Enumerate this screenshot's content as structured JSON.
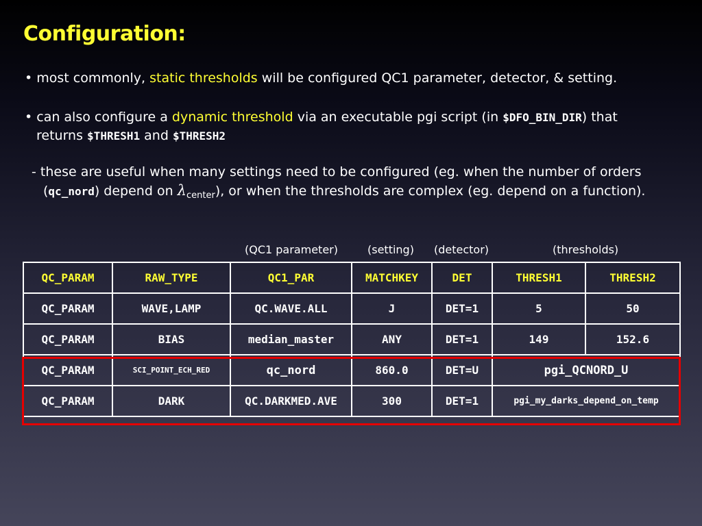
{
  "title": "Configuration:",
  "bullet1": {
    "prefix": "• most commonly, ",
    "highlight": "static thresholds",
    "suffix": " will be configured QC1 parameter, detector, & setting."
  },
  "bullet2": {
    "prefix": "• can also configure a ",
    "highlight": "dynamic threshold",
    "mid": " via an executable pgi script (in ",
    "code_dir": "$DFO_BIN_DIR",
    "after_dir": ") that",
    "line2_pre": "returns ",
    "code_t1": "$THRESH1",
    "and": " and ",
    "code_t2": "$THRESH2"
  },
  "bullet3": {
    "line1": "- these are useful when many settings need to be configured (eg. when the number of orders",
    "open": "(",
    "code": "qc_nord",
    "dep": ") depend on ",
    "lambda": "λ",
    "sub": "center",
    "rest": "), or when the thresholds are complex (eg. depend on a function)."
  },
  "captions": {
    "qc1": "(QC1 parameter)",
    "setting": "(setting)",
    "detector": "(detector)",
    "thresholds": "(thresholds)"
  },
  "table": {
    "headers": [
      "QC_PARAM",
      "RAW_TYPE",
      "QC1_PAR",
      "MATCHKEY",
      "DET",
      "THRESH1",
      "THRESH2"
    ],
    "rows": [
      [
        "QC_PARAM",
        "WAVE,LAMP",
        "QC.WAVE.ALL",
        "J",
        "DET=1",
        "5",
        "50"
      ],
      [
        "QC_PARAM",
        "BIAS",
        "median_master",
        "ANY",
        "DET=1",
        "149",
        "152.6"
      ],
      [
        "QC_PARAM",
        "SCI_POINT_ECH_RED",
        "qc_nord",
        "860.0",
        "DET=U",
        "pgi_QCNORD_U"
      ],
      [
        "QC_PARAM",
        "DARK",
        "QC.DARKMED.AVE",
        "300",
        "DET=1",
        "pgi_my_darks_depend_on_temp"
      ]
    ]
  },
  "colors": {
    "accent": "#ffff33",
    "highlight_box": "#e60000",
    "text": "#ffffff"
  }
}
